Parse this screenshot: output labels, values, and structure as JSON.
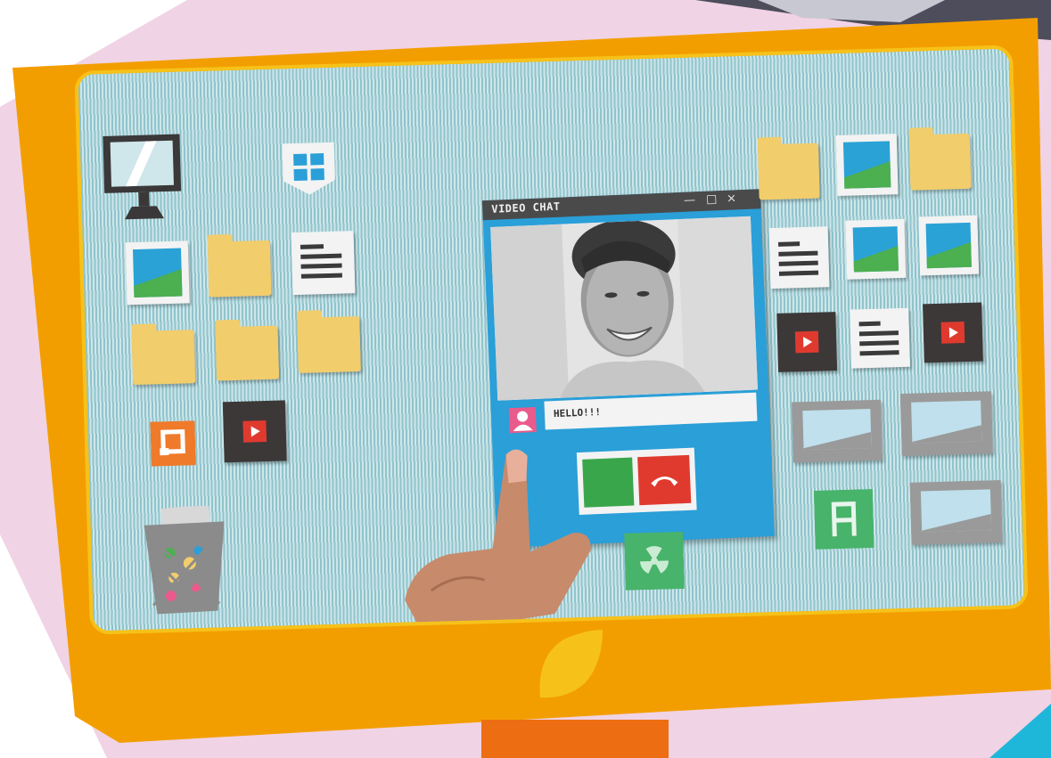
{
  "chat_window": {
    "title": "VIDEO CHAT",
    "minimize_glyph": "—",
    "maximize_glyph": "□",
    "close_glyph": "×",
    "message": "HELLO!!!"
  },
  "icons": [
    "monitor-icon",
    "shield-icon",
    "image-icon",
    "folder-icon",
    "document-icon",
    "music-icon",
    "video-play-icon",
    "trash-icon",
    "radiation-icon",
    "font-icon",
    "phone-accept-icon",
    "phone-hangup-icon",
    "user-avatar-icon"
  ],
  "colors": {
    "frame": "#f39e00",
    "frame_inner_border": "#f6c21a",
    "screen_stripes": "#8fc4cc",
    "chat_window": "#2a9fd8",
    "accept": "#3aa64b",
    "reject": "#e03a2f",
    "avatar": "#e95b8c",
    "stand": "#ec6d12",
    "logo": "#f6c21a",
    "background": "#f0d3e4"
  }
}
